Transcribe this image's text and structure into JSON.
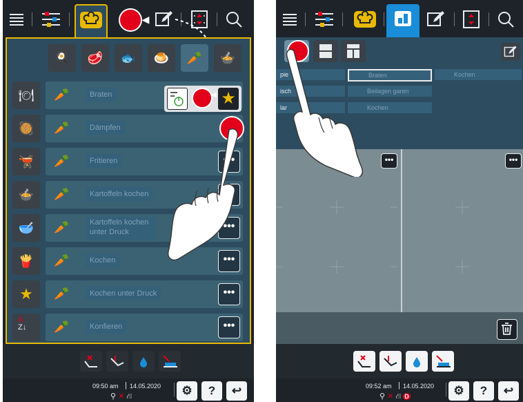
{
  "left": {
    "recipes": [
      {
        "label": "Braten"
      },
      {
        "label": "Dämpfen"
      },
      {
        "label": "Fritieren"
      },
      {
        "label": "Kartoffeln kochen"
      },
      {
        "label": "Kartoffeln kochen unter Druck"
      },
      {
        "label": "Kochen"
      },
      {
        "label": "Kochen unter Druck"
      },
      {
        "label": "Konfieren"
      }
    ],
    "more_label": "•••",
    "status": {
      "time": "09:50 am",
      "date": "14.05.2020"
    },
    "help_label": "?"
  },
  "right": {
    "list_left": [
      "pie",
      "isch",
      "lar"
    ],
    "list_mid": [
      "Braten",
      "Beilagen garen",
      "Kochen"
    ],
    "list_right": [
      "Kochen"
    ],
    "more_label": "•••",
    "status": {
      "time": "09:52 am",
      "date": "14.05.2020"
    },
    "help_label": "?"
  },
  "colors": {
    "accent": "#e8b900",
    "highlight": "#e2001a",
    "panel": "#2d4c5f",
    "selected_tab": "#1a8dd8"
  }
}
